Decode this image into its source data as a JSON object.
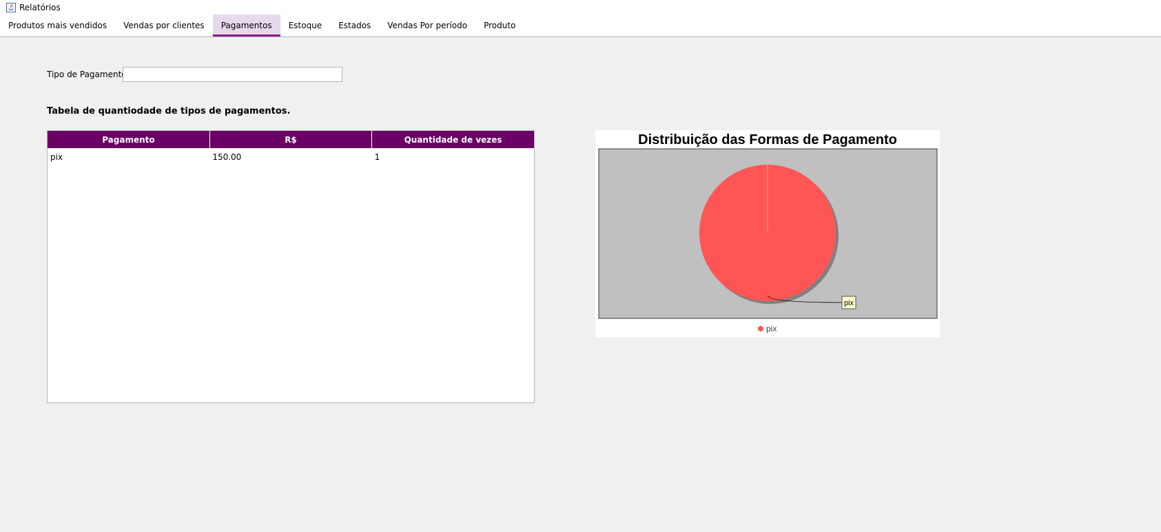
{
  "window": {
    "title": "Relatórios"
  },
  "tabs": [
    {
      "label": "Produtos mais vendidos",
      "active": false
    },
    {
      "label": "Vendas por clientes",
      "active": false
    },
    {
      "label": "Pagamentos",
      "active": true
    },
    {
      "label": "Estoque",
      "active": false
    },
    {
      "label": "Estados",
      "active": false
    },
    {
      "label": "Vendas Por período",
      "active": false
    },
    {
      "label": "Produto",
      "active": false
    }
  ],
  "filter": {
    "label": "Tipo de Pagamento",
    "value": "",
    "placeholder": ""
  },
  "section": {
    "heading": "Tabela de quantiodade de tipos de pagamentos."
  },
  "table": {
    "columns": [
      "Pagamento",
      "R$",
      "Quantidade de vezes"
    ],
    "rows": [
      [
        "pix",
        "150.00",
        "1"
      ]
    ]
  },
  "chart_data": {
    "type": "pie",
    "title": "Distribuição das Formas de Pagamento",
    "categories": [
      "pix"
    ],
    "values": [
      1
    ],
    "slice_labels": [
      "pix"
    ],
    "legend": {
      "placement": "bottom",
      "entries": [
        "pix"
      ]
    },
    "colors": {
      "slice": "#ff5555",
      "plot_background": "#c0c0c0",
      "label_box": "#ffffcc"
    }
  },
  "colors": {
    "header_bg": "#6a0066",
    "tab_accent": "#8e1b8e"
  }
}
